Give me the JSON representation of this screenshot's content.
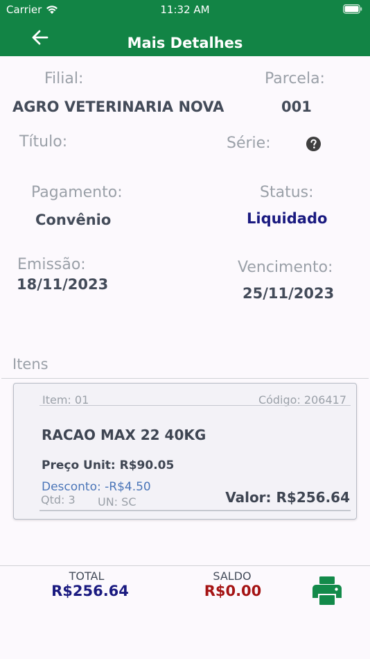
{
  "status_bar": {
    "carrier": "Carrier",
    "time": "11:32 AM"
  },
  "nav": {
    "title": "Mais Detalhes"
  },
  "details": {
    "filial_label": "Filial:",
    "filial_value": "AGRO VETERINARIA NOVA",
    "parcela_label": "Parcela:",
    "parcela_value": "001",
    "titulo_label": "Título:",
    "serie_label": "Série:",
    "pagamento_label": "Pagamento:",
    "pagamento_value": "Convênio",
    "status_label": "Status:",
    "status_value": "Liquidado",
    "emissao_label": "Emissão:",
    "emissao_value": "18/11/2023",
    "vencimento_label": "Vencimento:",
    "vencimento_value": "25/11/2023"
  },
  "itens": {
    "section_label": "Itens",
    "items": [
      {
        "item": "Item: 01",
        "codigo": "Código: 206417",
        "produto": "RACAO MAX 22 40KG",
        "preco": "Preço Unit: R$90.05",
        "desconto": "Desconto: -R$4.50",
        "qtd": "Qtd: 3",
        "un": "UN: SC",
        "valor": "Valor: R$256.64"
      }
    ]
  },
  "footer": {
    "total_label": "TOTAL",
    "total_value": "R$256.64",
    "saldo_label": "SALDO",
    "saldo_value": "R$0.00"
  },
  "colors": {
    "header": "#128445",
    "status_value": "#1a1a80",
    "total_value": "#1a1a80",
    "saldo_value": "#a51414",
    "desconto": "#4a75b8",
    "print_icon": "#138a4a"
  },
  "icons": {
    "wifi": "wifi-icon",
    "battery": "battery-icon",
    "back": "back-arrow-icon",
    "help": "question-circle-icon",
    "print": "printer-icon"
  }
}
